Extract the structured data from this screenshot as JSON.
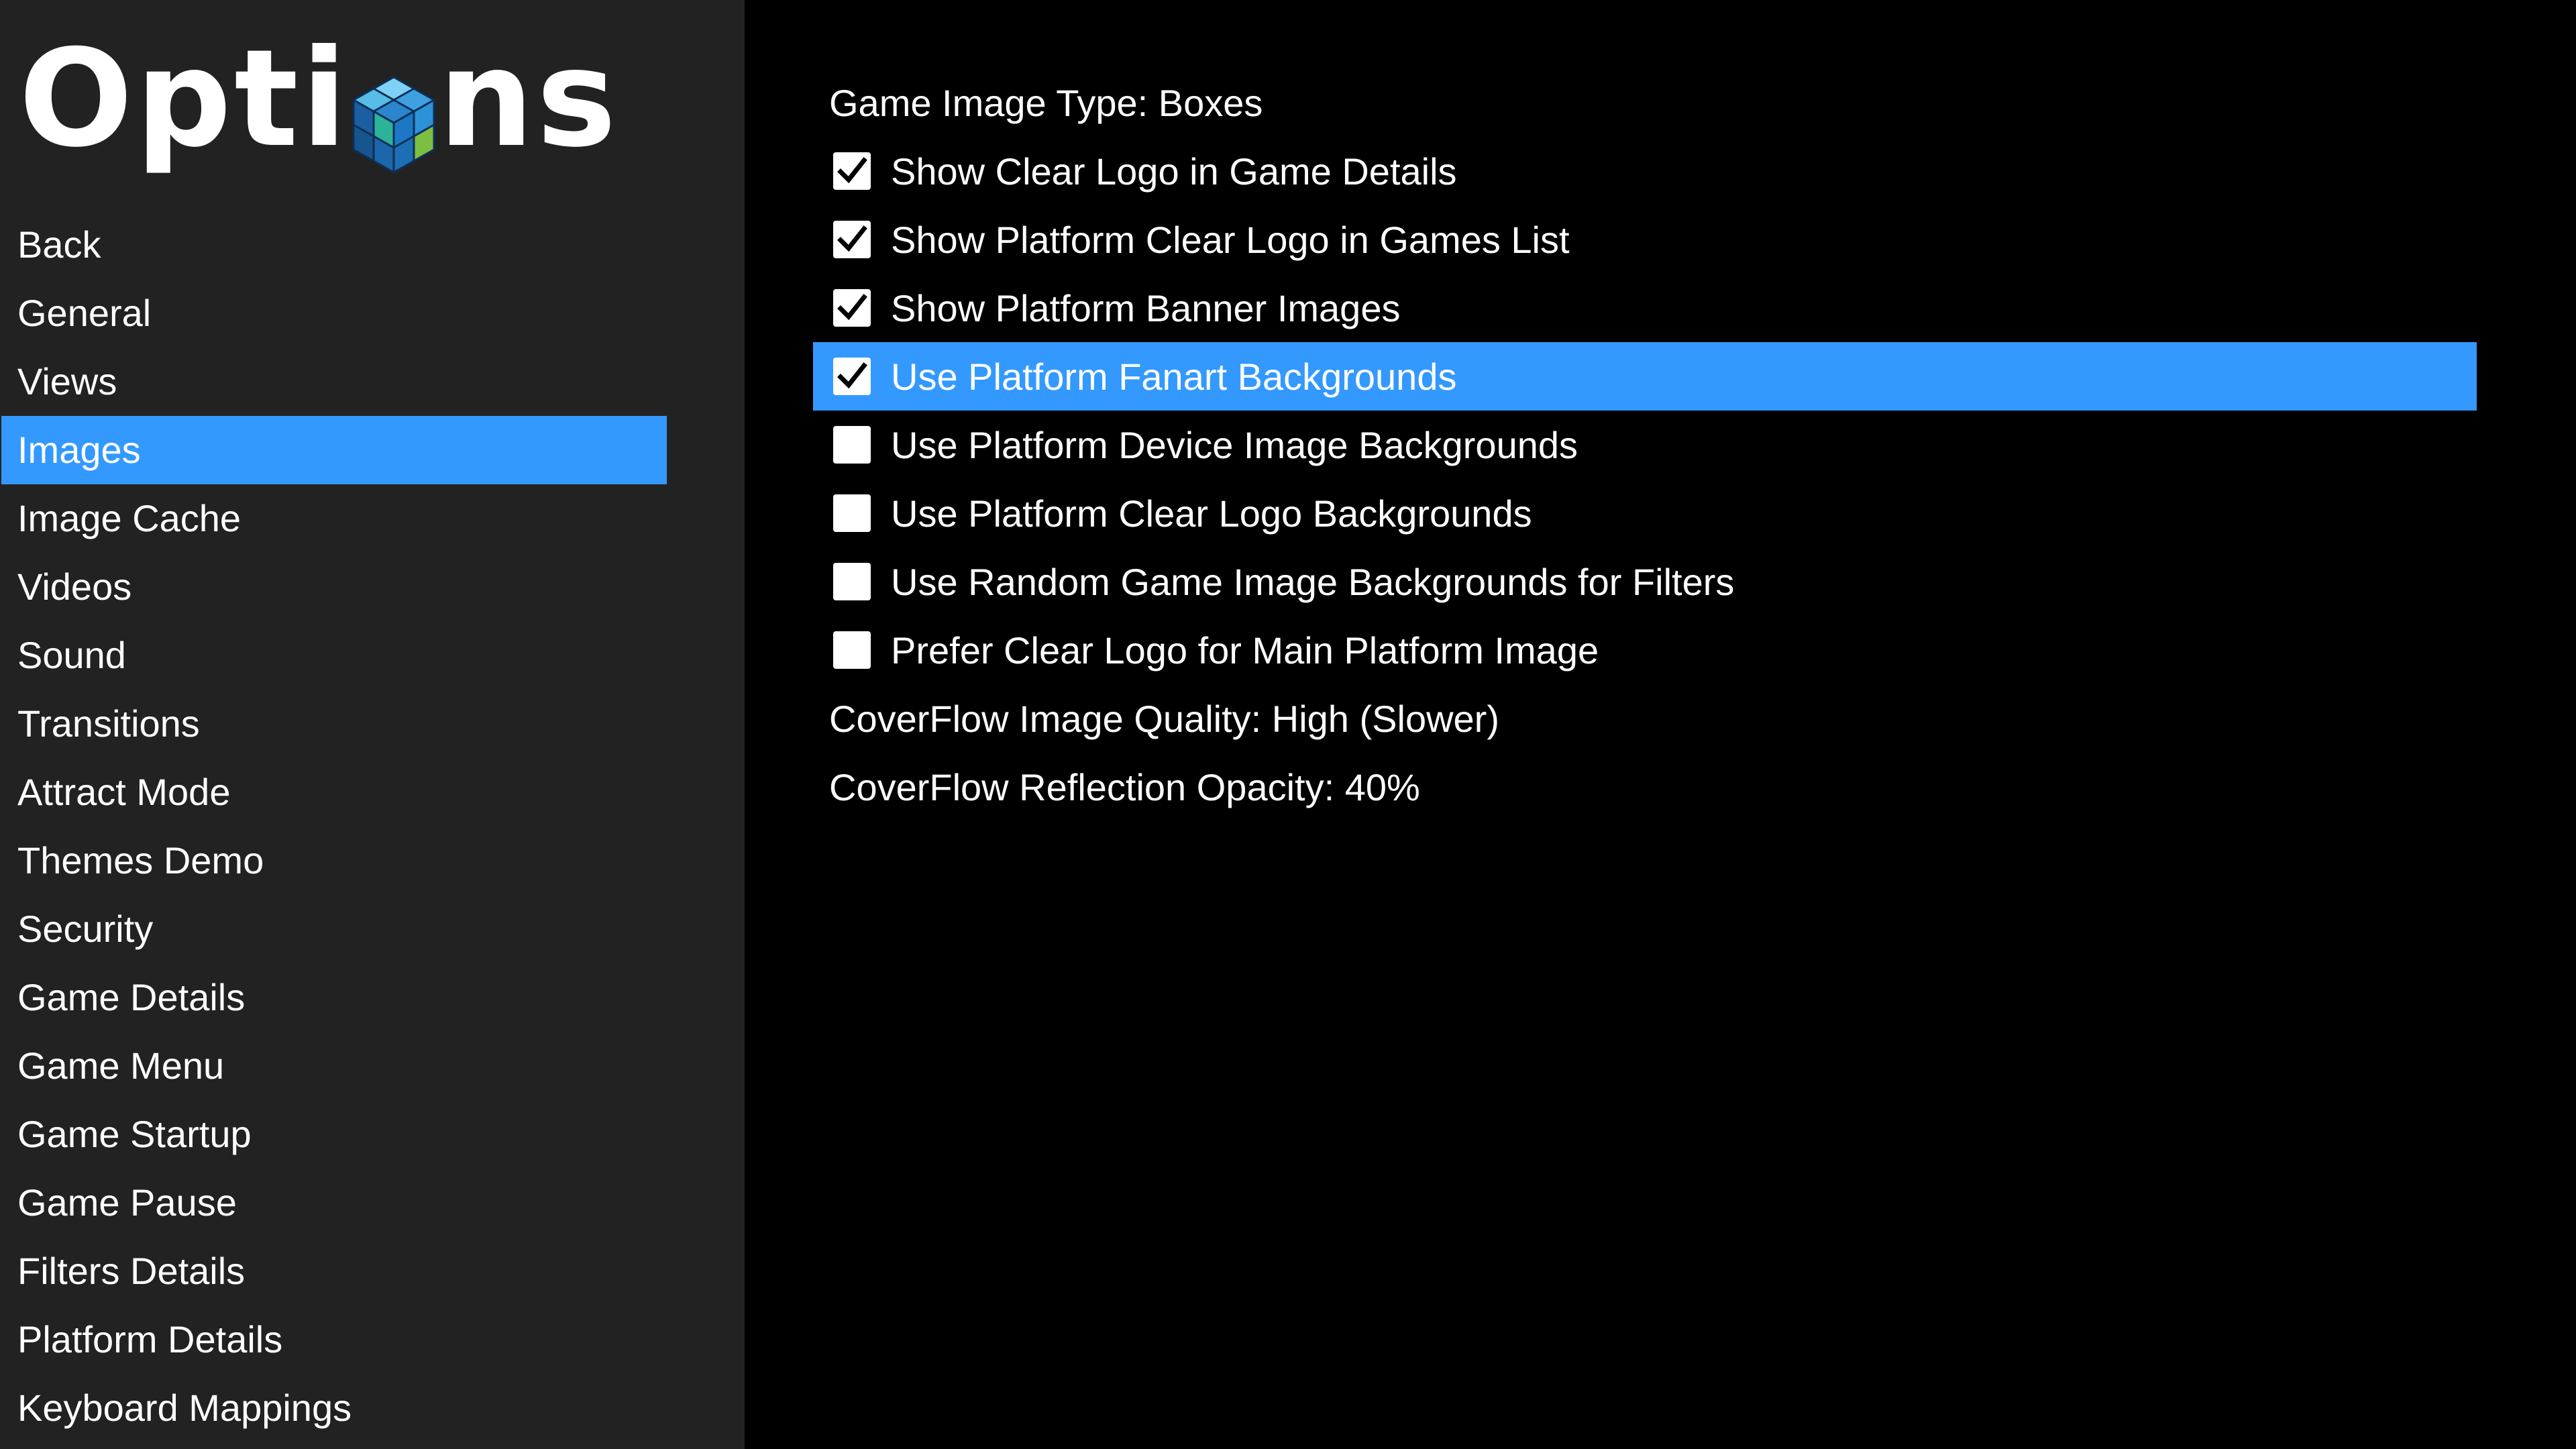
{
  "header": {
    "title_left": "Opti",
    "title_right": "ns",
    "logo_icon": "cube-logo-icon"
  },
  "sidebar": {
    "items": [
      {
        "label": "Back",
        "selected": false
      },
      {
        "label": "General",
        "selected": false
      },
      {
        "label": "Views",
        "selected": false
      },
      {
        "label": "Images",
        "selected": true
      },
      {
        "label": "Image Cache",
        "selected": false
      },
      {
        "label": "Videos",
        "selected": false
      },
      {
        "label": "Sound",
        "selected": false
      },
      {
        "label": "Transitions",
        "selected": false
      },
      {
        "label": "Attract Mode",
        "selected": false
      },
      {
        "label": "Themes Demo",
        "selected": false
      },
      {
        "label": "Security",
        "selected": false
      },
      {
        "label": "Game Details",
        "selected": false
      },
      {
        "label": "Game Menu",
        "selected": false
      },
      {
        "label": "Game Startup",
        "selected": false
      },
      {
        "label": "Game Pause",
        "selected": false
      },
      {
        "label": "Filters Details",
        "selected": false
      },
      {
        "label": "Platform Details",
        "selected": false
      },
      {
        "label": "Keyboard Mappings",
        "selected": false
      }
    ]
  },
  "main": {
    "options": [
      {
        "label": "Game Image Type: Boxes",
        "type": "value"
      },
      {
        "label": "Show Clear Logo in Game Details",
        "type": "checkbox",
        "checked": true
      },
      {
        "label": "Show Platform Clear Logo in Games List",
        "type": "checkbox",
        "checked": true
      },
      {
        "label": "Show Platform Banner Images",
        "type": "checkbox",
        "checked": true
      },
      {
        "label": "Use Platform Fanart Backgrounds",
        "type": "checkbox",
        "checked": true,
        "selected": true
      },
      {
        "label": "Use Platform Device Image Backgrounds",
        "type": "checkbox",
        "checked": false
      },
      {
        "label": "Use Platform Clear Logo Backgrounds",
        "type": "checkbox",
        "checked": false
      },
      {
        "label": "Use Random Game Image Backgrounds for Filters",
        "type": "checkbox",
        "checked": false
      },
      {
        "label": "Prefer Clear Logo for Main Platform Image",
        "type": "checkbox",
        "checked": false
      },
      {
        "label": "CoverFlow Image Quality: High (Slower)",
        "type": "value"
      },
      {
        "label": "CoverFlow Reflection Opacity: 40%",
        "type": "value"
      }
    ]
  },
  "colors": {
    "sidebar_bg": "#222222",
    "main_bg": "#000000",
    "accent": "#3399ff",
    "text": "#ffffff"
  }
}
